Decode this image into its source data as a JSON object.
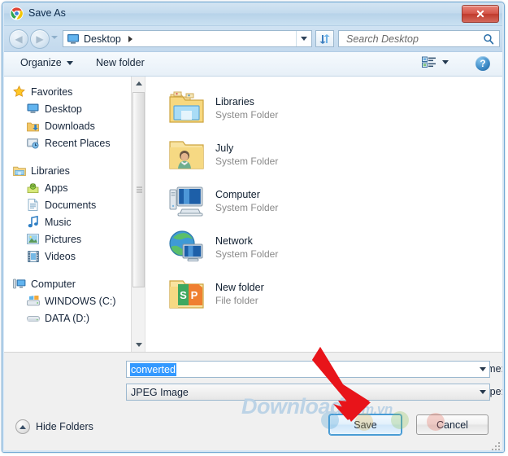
{
  "window": {
    "title": "Save As",
    "app_icon": "chrome-logo-icon",
    "close_label": "Close"
  },
  "navbar": {
    "back_icon": "back-arrow-icon",
    "forward_icon": "forward-arrow-icon",
    "history_dropdown_icon": "chevron-down-icon",
    "path_icon": "desktop-monitor-icon",
    "path_label": "Desktop",
    "path_dropdown_icon": "chevron-down-icon",
    "refresh_icon": "refresh-icon",
    "search_placeholder": "Search Desktop",
    "search_value": "",
    "search_icon": "search-icon"
  },
  "toolbar": {
    "organize_label": "Organize",
    "organize_caret_icon": "chevron-down-icon",
    "new_folder_label": "New folder",
    "view_icon": "view-options-icon",
    "view_caret_icon": "chevron-down-icon",
    "help_label": "?",
    "help_icon": "help-icon"
  },
  "sidebar": {
    "items": [
      {
        "label": "Favorites",
        "icon": "star-icon",
        "level": "group"
      },
      {
        "label": "Desktop",
        "icon": "desktop-icon",
        "level": "child"
      },
      {
        "label": "Downloads",
        "icon": "downloads-icon",
        "level": "child"
      },
      {
        "label": "Recent Places",
        "icon": "recent-places-icon",
        "level": "child"
      },
      {
        "label": "Libraries",
        "icon": "libraries-icon",
        "level": "group"
      },
      {
        "label": "Apps",
        "icon": "apps-icon",
        "level": "child"
      },
      {
        "label": "Documents",
        "icon": "documents-icon",
        "level": "child"
      },
      {
        "label": "Music",
        "icon": "music-icon",
        "level": "child"
      },
      {
        "label": "Pictures",
        "icon": "pictures-icon",
        "level": "child"
      },
      {
        "label": "Videos",
        "icon": "videos-icon",
        "level": "child"
      },
      {
        "label": "Computer",
        "icon": "computer-icon",
        "level": "group"
      },
      {
        "label": "WINDOWS (C:)",
        "icon": "windows-drive-icon",
        "level": "child"
      },
      {
        "label": "DATA (D:)",
        "icon": "drive-icon",
        "level": "child"
      }
    ]
  },
  "filelist": {
    "items": [
      {
        "name": "Libraries",
        "type": "System Folder",
        "icon": "libraries-folder-icon"
      },
      {
        "name": "July",
        "type": "System Folder",
        "icon": "user-folder-icon"
      },
      {
        "name": "Computer",
        "type": "System Folder",
        "icon": "computer-monitor-icon"
      },
      {
        "name": "Network",
        "type": "System Folder",
        "icon": "network-globe-icon"
      },
      {
        "name": "New folder",
        "type": "File folder",
        "icon": "new-folder-icon"
      }
    ]
  },
  "form": {
    "filename_label": "File name:",
    "filename_value": "converted",
    "filename_caret_icon": "chevron-down-icon",
    "filetype_label": "Save as type:",
    "filetype_value": "JPEG Image",
    "filetype_caret_icon": "chevron-down-icon"
  },
  "footer": {
    "hide_folders_label": "Hide Folders",
    "hide_folders_icon": "chevron-up-circle-icon",
    "save_label": "Save",
    "cancel_label": "Cancel"
  },
  "overlay": {
    "watermark_main": "Download",
    "watermark_suffix": ".com.vn",
    "arrow_icon": "red-arrow-pointer"
  },
  "colors": {
    "accent_blue": "#3c96d6",
    "selection_blue": "#3399ff",
    "close_red": "#c0392b",
    "arrow_red": "#e8141a",
    "watermark_blue": "#bcd3e6"
  }
}
